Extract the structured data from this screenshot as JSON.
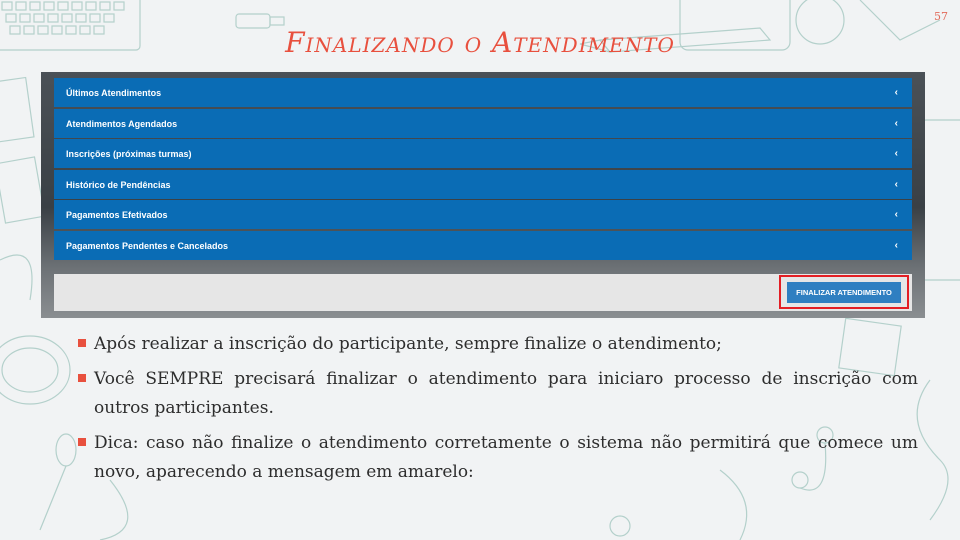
{
  "slide": {
    "title": "Finalizando o Atendimento",
    "page_number": "57"
  },
  "menu": {
    "items": [
      {
        "label": "Últimos Atendimentos"
      },
      {
        "label": "Atendimentos Agendados"
      },
      {
        "label": "Inscrições (próximas turmas)"
      },
      {
        "label": "Histórico de Pendências"
      },
      {
        "label": "Pagamentos Efetivados"
      },
      {
        "label": "Pagamentos Pendentes e Cancelados"
      }
    ],
    "chevron_icon": "chevron-left-icon"
  },
  "footer": {
    "finalize_label": "FINALIZAR ATENDIMENTO",
    "highlight_color": "#e31e24"
  },
  "bullets": [
    {
      "text": "Após realizar a inscrição do participante, sempre finalize o atendimento;"
    },
    {
      "text": "Você SEMPRE precisará finalizar o atendimento para iniciaro processo de inscrição com outros participantes."
    },
    {
      "text": "Dica: caso não finalize o atendimento corretamente o sistema não permitirá que comece um novo, aparecendo a mensagem em amarelo:"
    }
  ],
  "colors": {
    "title": "#e8503e",
    "menu_bg": "#0a6cb5",
    "button_bg": "#2f7fc1",
    "bullet_marker": "#e8503e"
  }
}
